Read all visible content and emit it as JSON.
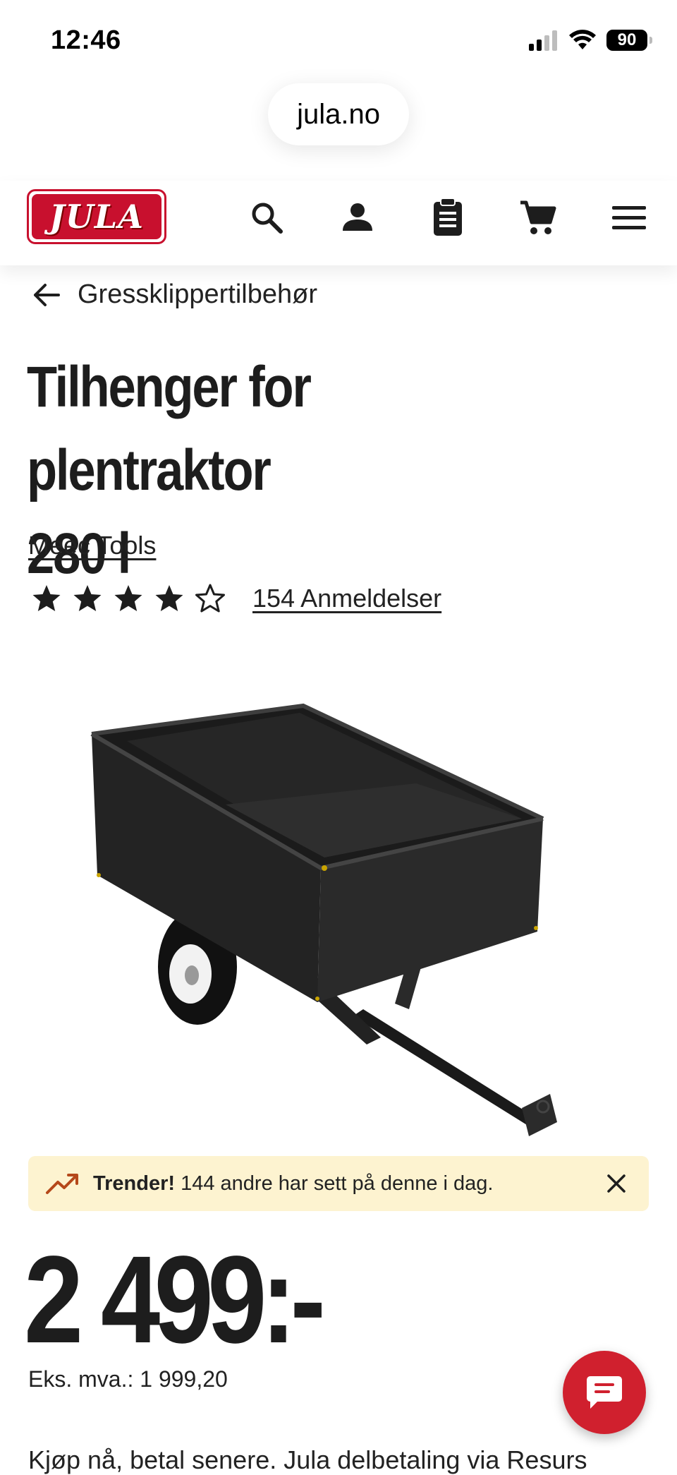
{
  "status_bar": {
    "time": "12:46",
    "battery": "90"
  },
  "browser": {
    "url": "jula.no"
  },
  "header": {
    "logo_text": "JULA",
    "icons": [
      "search-icon",
      "account-icon",
      "clipboard-icon",
      "cart-icon",
      "menu-icon"
    ]
  },
  "breadcrumb": {
    "label": "Gressklippertilbehør"
  },
  "product": {
    "title_line1": "Tilhenger for plentraktor",
    "title_line2": "280 l",
    "brand": "Meec Tools",
    "rating_value": 4,
    "rating_max": 5,
    "reviews_label": "154 Anmeldelser",
    "price": "2 499:-",
    "ex_vat": "Eks. mva.: 1 999,20"
  },
  "trend_banner": {
    "strong": "Trender!",
    "text": " 144 andre har sett på denne i dag."
  },
  "bottom": {
    "partial_text": "Kjøp nå, betal senere. Jula delbetaling via Resurs"
  },
  "colors": {
    "brand_red": "#c8102e",
    "trend_bg": "#fdf3d0",
    "trend_icon": "#b5481a",
    "chat_red": "#d0202e"
  }
}
